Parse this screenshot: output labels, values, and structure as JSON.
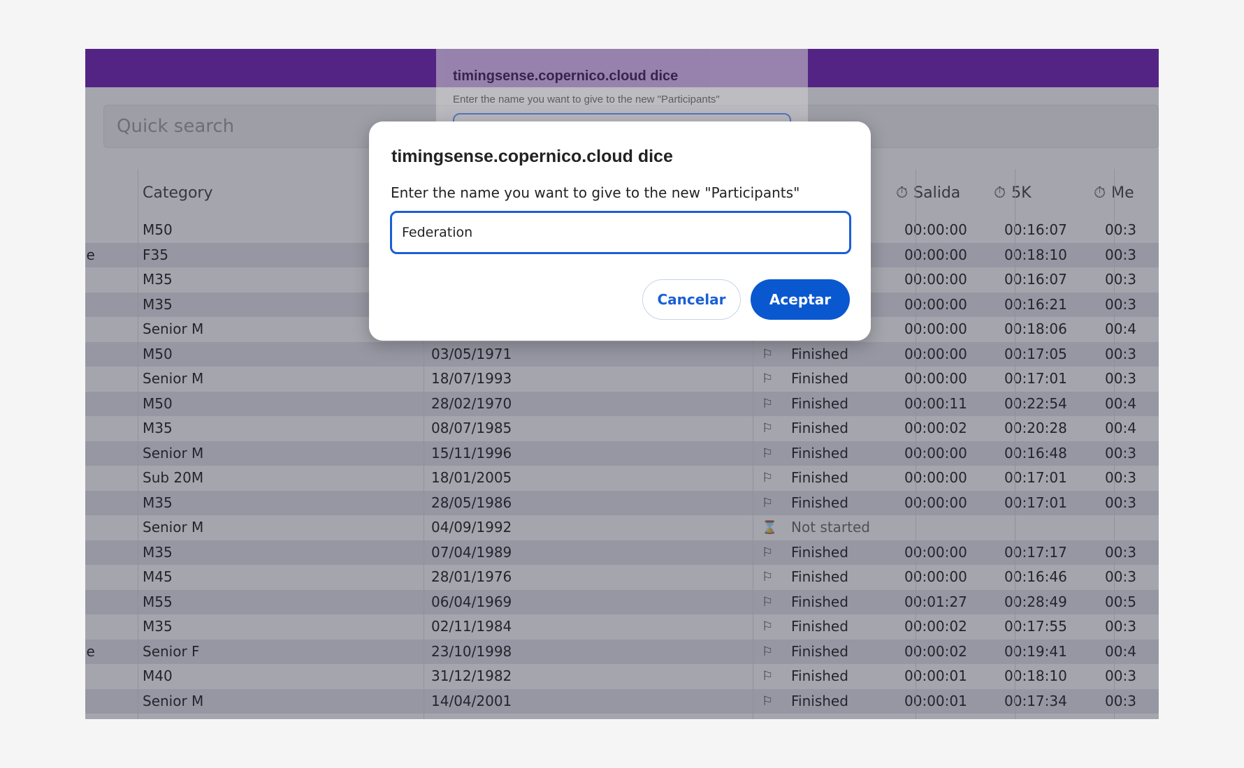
{
  "search": {
    "placeholder": "Quick search"
  },
  "table": {
    "columns": {
      "category": "Category",
      "salida": "Salida",
      "5k": "5K",
      "meta": "Me"
    },
    "rows": [
      {
        "lead": "",
        "category": "M50",
        "birth": "",
        "status": "",
        "salida": "00:00:00",
        "5k": "00:16:07",
        "meta": "00:3"
      },
      {
        "lead": "le",
        "category": "F35",
        "birth": "",
        "status": "",
        "salida": "00:00:00",
        "5k": "00:18:10",
        "meta": "00:3"
      },
      {
        "lead": "",
        "category": "M35",
        "birth": "",
        "status": "",
        "salida": "00:00:00",
        "5k": "00:16:07",
        "meta": "00:3"
      },
      {
        "lead": "",
        "category": "M35",
        "birth": "",
        "status": "",
        "salida": "00:00:00",
        "5k": "00:16:21",
        "meta": "00:3"
      },
      {
        "lead": "",
        "category": "Senior M",
        "birth": "",
        "status": "",
        "salida": "00:00:00",
        "5k": "00:18:06",
        "meta": "00:4"
      },
      {
        "lead": "",
        "category": "M50",
        "birth": "03/05/1971",
        "status": "Finished",
        "salida": "00:00:00",
        "5k": "00:17:05",
        "meta": "00:3"
      },
      {
        "lead": "",
        "category": "Senior M",
        "birth": "18/07/1993",
        "status": "Finished",
        "salida": "00:00:00",
        "5k": "00:17:01",
        "meta": "00:3"
      },
      {
        "lead": "",
        "category": "M50",
        "birth": "28/02/1970",
        "status": "Finished",
        "salida": "00:00:11",
        "5k": "00:22:54",
        "meta": "00:4"
      },
      {
        "lead": "",
        "category": "M35",
        "birth": "08/07/1985",
        "status": "Finished",
        "salida": "00:00:02",
        "5k": "00:20:28",
        "meta": "00:4"
      },
      {
        "lead": "",
        "category": "Senior M",
        "birth": "15/11/1996",
        "status": "Finished",
        "salida": "00:00:00",
        "5k": "00:16:48",
        "meta": "00:3"
      },
      {
        "lead": "",
        "category": "Sub 20M",
        "birth": "18/01/2005",
        "status": "Finished",
        "salida": "00:00:00",
        "5k": "00:17:01",
        "meta": "00:3"
      },
      {
        "lead": "",
        "category": "M35",
        "birth": "28/05/1986",
        "status": "Finished",
        "salida": "00:00:00",
        "5k": "00:17:01",
        "meta": "00:3"
      },
      {
        "lead": "",
        "category": "Senior M",
        "birth": "04/09/1992",
        "status": "Not started",
        "salida": "",
        "5k": "",
        "meta": ""
      },
      {
        "lead": "",
        "category": "M35",
        "birth": "07/04/1989",
        "status": "Finished",
        "salida": "00:00:00",
        "5k": "00:17:17",
        "meta": "00:3"
      },
      {
        "lead": "",
        "category": "M45",
        "birth": "28/01/1976",
        "status": "Finished",
        "salida": "00:00:00",
        "5k": "00:16:46",
        "meta": "00:3"
      },
      {
        "lead": "",
        "category": "M55",
        "birth": "06/04/1969",
        "status": "Finished",
        "salida": "00:01:27",
        "5k": "00:28:49",
        "meta": "00:5"
      },
      {
        "lead": "",
        "category": "M35",
        "birth": "02/11/1984",
        "status": "Finished",
        "salida": "00:00:02",
        "5k": "00:17:55",
        "meta": "00:3"
      },
      {
        "lead": "le",
        "category": "Senior F",
        "birth": "23/10/1998",
        "status": "Finished",
        "salida": "00:00:02",
        "5k": "00:19:41",
        "meta": "00:4"
      },
      {
        "lead": "",
        "category": "M40",
        "birth": "31/12/1982",
        "status": "Finished",
        "salida": "00:00:01",
        "5k": "00:18:10",
        "meta": "00:3"
      },
      {
        "lead": "",
        "category": "Senior M",
        "birth": "14/04/2001",
        "status": "Finished",
        "salida": "00:00:01",
        "5k": "00:17:34",
        "meta": "00:3"
      }
    ]
  },
  "ghost_dialog": {
    "title": "timingsense.copernico.cloud dice",
    "message": "Enter the name you want to give to the new \"Participants\""
  },
  "dialog": {
    "title": "timingsense.copernico.cloud dice",
    "message": "Enter the name you want to give to the new \"Participants\"",
    "input_value": "Federation",
    "cancel_label": "Cancelar",
    "ok_label": "Aceptar"
  },
  "colors": {
    "topbar": "#7421b8",
    "accent": "#0a58d0"
  },
  "icons": {
    "finished": "checkered-flag-icon",
    "not_started": "hourglass-icon",
    "timer": "stopwatch-icon"
  }
}
